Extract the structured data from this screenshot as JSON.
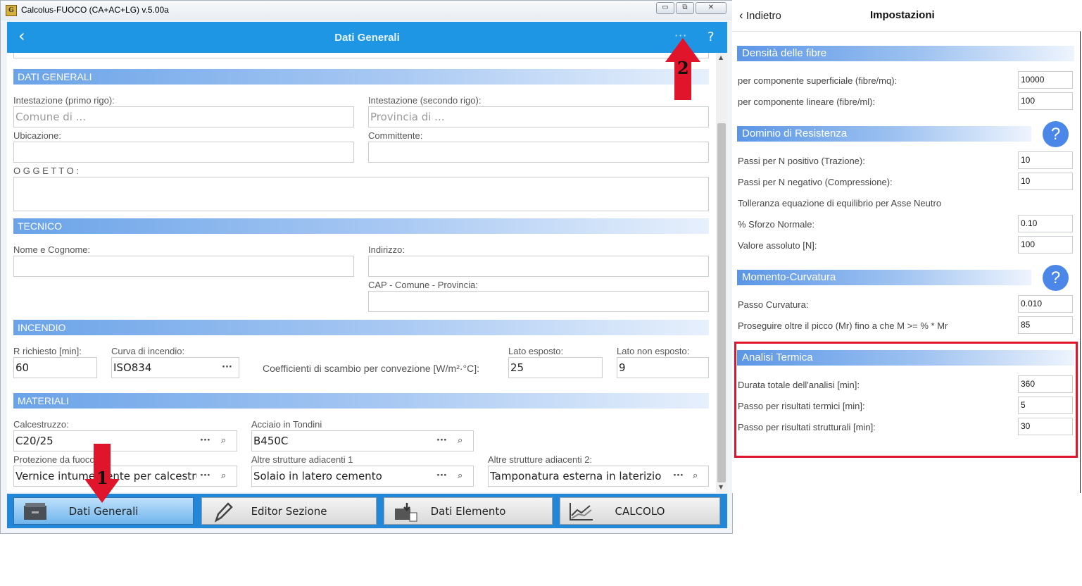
{
  "window": {
    "title": "Calcolus-FUOCO (CA+AC+LG) v.5.00a",
    "app_icon_glyph": "G",
    "controls": {
      "minimize": "▭",
      "maximize": "⧉",
      "close": "✕"
    }
  },
  "header": {
    "back": "‹",
    "title": "Dati Generali",
    "more": "···",
    "help": "?"
  },
  "sections": {
    "dati_generali": "DATI GENERALI",
    "tecnico": "TECNICO",
    "incendio": "INCENDIO",
    "materiali": "MATERIALI"
  },
  "dati_generali": {
    "intestazione1_label": "Intestazione  (primo rigo):",
    "intestazione1_placeholder": "Comune di ...",
    "intestazione2_label": "Intestazione  (secondo rigo):",
    "intestazione2_placeholder": "Provincia di ...",
    "ubicazione_label": "Ubicazione:",
    "committente_label": "Committente:",
    "oggetto_label": "O G G E T T O :"
  },
  "tecnico": {
    "nome_label": "Nome e Cognome:",
    "indirizzo_label": "Indirizzo:",
    "cap_label": "CAP - Comune - Provincia:"
  },
  "incendio": {
    "r_label": "R richiesto [min]:",
    "r_value": "60",
    "curva_label": "Curva di incendio:",
    "curva_value": "ISO834",
    "coeff_label": "Coefficienti di scambio per convezione [W/m²·°C]:",
    "lato_esposto_label": "Lato esposto:",
    "lato_esposto_value": "25",
    "lato_non_esposto_label": "Lato non esposto:",
    "lato_non_esposto_value": "9"
  },
  "materiali": {
    "cls_label": "Calcestruzzo:",
    "cls_value": "C20/25",
    "acciaio_label": "Acciaio in Tondini",
    "acciaio_value": "B450C",
    "protezione_label": "Protezione da fuoco",
    "protezione_value": "Vernice intumescente per calcestruzzo",
    "adiacenti1_label": "Altre strutture adiacenti 1",
    "adiacenti1_value": "Solaio in latero cemento",
    "adiacenti2_label": "Altre strutture adiacenti 2:",
    "adiacenti2_value": "Tamponatura esterna in laterizio",
    "dots": "···",
    "search_icon": "⌕"
  },
  "toolbar": {
    "dati_generali": "Dati Generali",
    "editor_sezione": "Editor Sezione",
    "dati_elemento": "Dati Elemento",
    "calcolo": "CALCOLO"
  },
  "annotations": {
    "arrow1": "1",
    "arrow2": "2",
    "color": "#e0142a"
  },
  "settings": {
    "back": "Indietro",
    "title": "Impostazioni",
    "help": "?",
    "fibre": {
      "title": "Densità delle fibre",
      "superficiale_label": "per componente superficiale (fibre/mq):",
      "superficiale_value": "10000",
      "lineare_label": "per componente lineare (fibre/ml):",
      "lineare_value": "100"
    },
    "dominio": {
      "title": "Dominio di Resistenza",
      "passi_pos_label": "Passi per N positivo (Trazione):",
      "passi_pos_value": "10",
      "passi_neg_label": "Passi per N negativo (Compressione):",
      "passi_neg_value": "10",
      "tolleranza_label": "Tolleranza equazione di equilibrio per Asse Neutro",
      "sforzo_label": "% Sforzo Normale:",
      "sforzo_value": "0.10",
      "assoluto_label": "Valore assoluto [N]:",
      "assoluto_value": "100"
    },
    "momento": {
      "title": "Momento-Curvatura",
      "passo_label": "Passo Curvatura:",
      "passo_value": "0.010",
      "picco_label": "Proseguire oltre il picco (Mr) fino a che M >= % * Mr",
      "picco_value": "85"
    },
    "termica": {
      "title": "Analisi Termica",
      "durata_label": "Durata totale dell'analisi [min]:",
      "durata_value": "360",
      "termici_label": "Passo per risultati termici [min]:",
      "termici_value": "5",
      "strutturali_label": "Passo per risultati strutturali [min]:",
      "strutturali_value": "30"
    }
  }
}
